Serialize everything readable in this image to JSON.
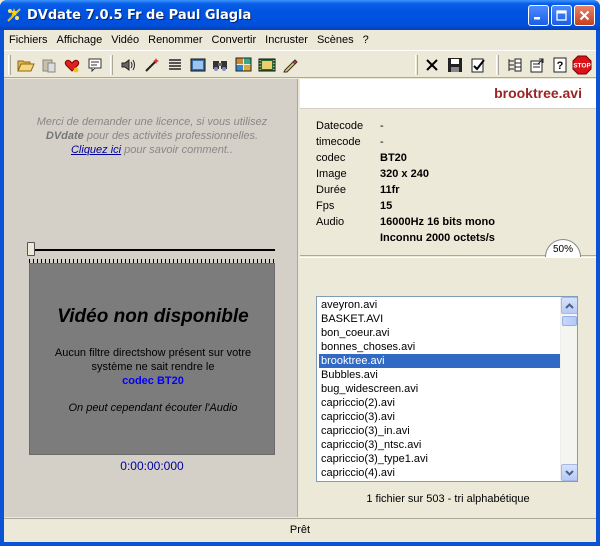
{
  "window": {
    "title": "DVdate 7.0.5 Fr de Paul Glagla",
    "icon": "dvdate-app-icon",
    "controls": {
      "minimize": "minimize-icon",
      "maximize": "maximize-icon",
      "close": "close-icon"
    }
  },
  "menu": [
    "Fichiers",
    "Affichage",
    "Vidéo",
    "Renommer",
    "Convertir",
    "Incruster",
    "Scènes",
    "?"
  ],
  "toolbar": {
    "left": [
      "open-folder-icon",
      "paste-icon",
      "favorite-heart-icon",
      "comment-icon",
      "sound-icon",
      "magic-wand-icon",
      "list-icon",
      "frame-icon",
      "find-icon",
      "image-grid-icon",
      "film-icon",
      "edit-pen-icon"
    ],
    "right": [
      "delete-x-icon",
      "save-icon",
      "checklist-icon",
      "tree-icon",
      "properties-icon",
      "help-icon",
      "stop-icon"
    ],
    "stop_label": "STOP"
  },
  "license": {
    "line1": "Merci de demander une licence, si vous utilisez",
    "app_name": "DVdate",
    "line2_rest": " pour des activités professionnelles.",
    "link": "Cliquez ici",
    "line3_rest": " pour savoir comment.."
  },
  "video": {
    "title": "Vidéo non disponible",
    "message_line1": "Aucun filtre directshow présent sur votre",
    "message_line2": "système ne sait rendre le",
    "codec_line": "codec BT20",
    "audio_note": "On peut cependant écouter l'Audio",
    "timecode": "0:00:00:000"
  },
  "file": {
    "name": "brooktree.avi",
    "info": [
      {
        "label": "Datecode",
        "value": "-",
        "bold": false
      },
      {
        "label": "timecode",
        "value": "-",
        "bold": false
      },
      {
        "label": "codec",
        "value": "BT20",
        "bold": true
      },
      {
        "label": "Image",
        "value": "320 x 240",
        "bold": true
      },
      {
        "label": "Durée",
        "value": "11fr",
        "bold": true
      },
      {
        "label": "Fps",
        "value": "15",
        "bold": true
      },
      {
        "label": "Audio",
        "value": "16000Hz 16 bits  mono",
        "bold": true
      },
      {
        "label": "",
        "value": "Inconnu 2000 octets/s",
        "bold": true
      }
    ],
    "gauge": "50%"
  },
  "filelist": {
    "items": [
      "aveyron.avi",
      "BASKET.AVI",
      "bon_coeur.avi",
      "bonnes_choses.avi",
      "brooktree.avi",
      "Bubbles.avi",
      "bug_widescreen.avi",
      "capriccio(2).avi",
      "capriccio(3).avi",
      "capriccio(3)_in.avi",
      "capriccio(3)_ntsc.avi",
      "capriccio(3)_type1.avi",
      "capriccio(4).avi"
    ],
    "selected_index": 4,
    "status": "1 fichier sur 503 - tri alphabétique"
  },
  "statusbar": {
    "text": "Prêt"
  }
}
